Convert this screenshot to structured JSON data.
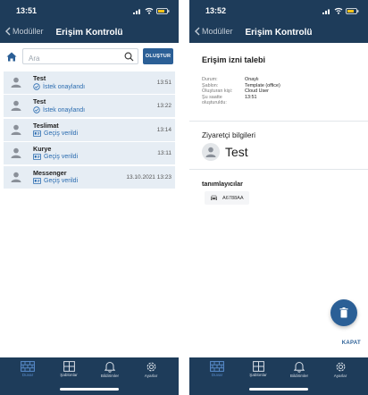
{
  "colors": {
    "header_bg": "#1e3c5a",
    "accent": "#2b5f96",
    "status_blue": "#2b6cb0",
    "row_bg": "#e6edf4"
  },
  "left": {
    "status_time": "13:51",
    "back_label": "Modüller",
    "title": "Erişim Kontrolü",
    "search": {
      "placeholder": "Ara",
      "value": ""
    },
    "create_label": "OLUŞTUR",
    "rows": [
      {
        "name": "Test",
        "status": "İstek onaylandı",
        "status_icon": "check-circle-icon",
        "time": "13:51"
      },
      {
        "name": "Test",
        "status": "İstek onaylandı",
        "status_icon": "check-circle-icon",
        "time": "13:22"
      },
      {
        "name": "Teslimat",
        "status": "Geçiş verildi",
        "status_icon": "pass-icon",
        "time": "13:14"
      },
      {
        "name": "Kurye",
        "status": "Geçiş verildi",
        "status_icon": "pass-icon",
        "time": "13:11"
      },
      {
        "name": "Messenger",
        "status": "Geçiş verildi",
        "status_icon": "pass-icon",
        "time": "13.10.2021 13:23"
      }
    ]
  },
  "right": {
    "status_time": "13:52",
    "back_label": "Modüller",
    "title": "Erişim Kontrolü",
    "detail_title": "Erişim izni talebi",
    "fields": [
      {
        "key": "Durum:",
        "value": "Onaylı"
      },
      {
        "key": "Şablon:",
        "value": "Template (office)"
      },
      {
        "key": "Oluşturan kişi:",
        "value": "Cloud User"
      },
      {
        "key": "Şu saatte",
        "value": "13:51"
      },
      {
        "key": "oluşturuldu:",
        "value": ""
      }
    ],
    "visitor_section_title": "Ziyaretçi bilgileri",
    "visitor_name": "Test",
    "identifiers_title": "tanımlayıcılar",
    "plate": "A6788AA",
    "close_label": "KAPAT"
  },
  "tabbar": [
    {
      "label": "Duvar",
      "icon": "wall-icon",
      "active": true
    },
    {
      "label": "Şablonlar",
      "icon": "templates-icon",
      "active": false
    },
    {
      "label": "Bildirimler",
      "icon": "bell-icon",
      "active": false
    },
    {
      "label": "Ayarlar",
      "icon": "gear-icon",
      "active": false
    }
  ]
}
